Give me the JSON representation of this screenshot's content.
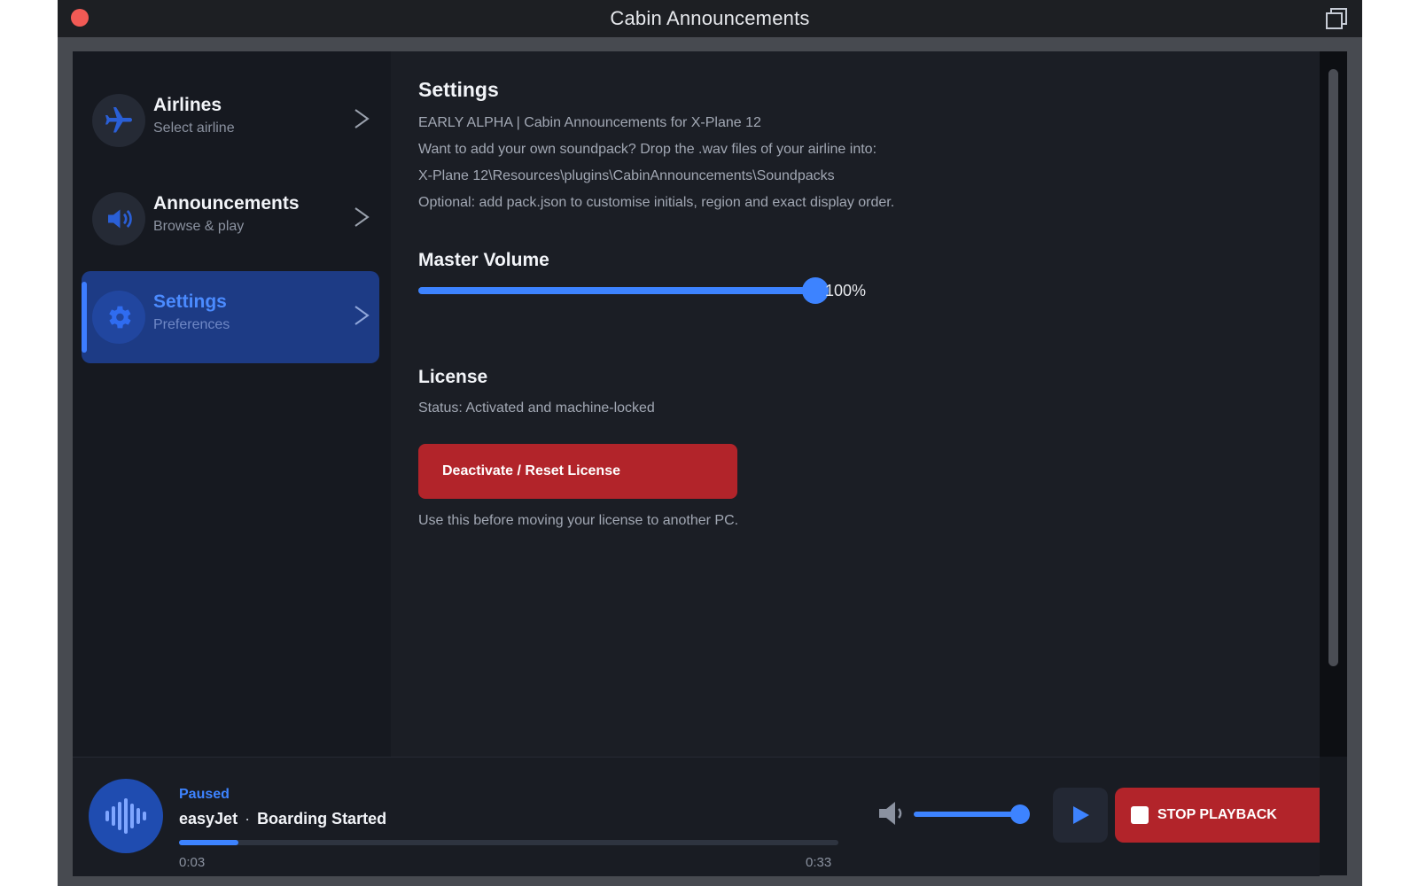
{
  "window": {
    "title": "Cabin Announcements"
  },
  "sidebar": {
    "items": [
      {
        "label": "Airlines",
        "sub": "Select airline",
        "icon": "airplane-icon",
        "active": false
      },
      {
        "label": "Announcements",
        "sub": "Browse & play",
        "icon": "speaker-icon",
        "active": false
      },
      {
        "label": "Settings",
        "sub": "Preferences",
        "icon": "gear-icon",
        "active": true
      }
    ]
  },
  "settings": {
    "title": "Settings",
    "info_lines": [
      "EARLY ALPHA  |  Cabin Announcements for X-Plane 12",
      "Want to add your own soundpack? Drop the .wav files of your airline into:",
      "X-Plane 12\\Resources\\plugins\\CabinAnnouncements\\Soundpacks",
      "Optional: add pack.json to customise initials, region and exact display order."
    ],
    "master_volume": {
      "label": "Master Volume",
      "value": 100,
      "value_text": "100%"
    },
    "license": {
      "label": "License",
      "status": "Status: Activated and machine-locked",
      "button": "Deactivate / Reset License",
      "note": "Use this before moving your license to another PC."
    }
  },
  "player": {
    "status": "Paused",
    "airline": "easyJet",
    "separator": "·",
    "track": "Boarding Started",
    "time_current": "0:03",
    "time_total": "0:33",
    "progress": 0.09,
    "volume": 1.0,
    "stop_label": "STOP PLAYBACK"
  },
  "colors": {
    "accent": "#3d83ff",
    "danger": "#b2242a",
    "active_nav": "#1d3b85",
    "background": "#15181e"
  }
}
